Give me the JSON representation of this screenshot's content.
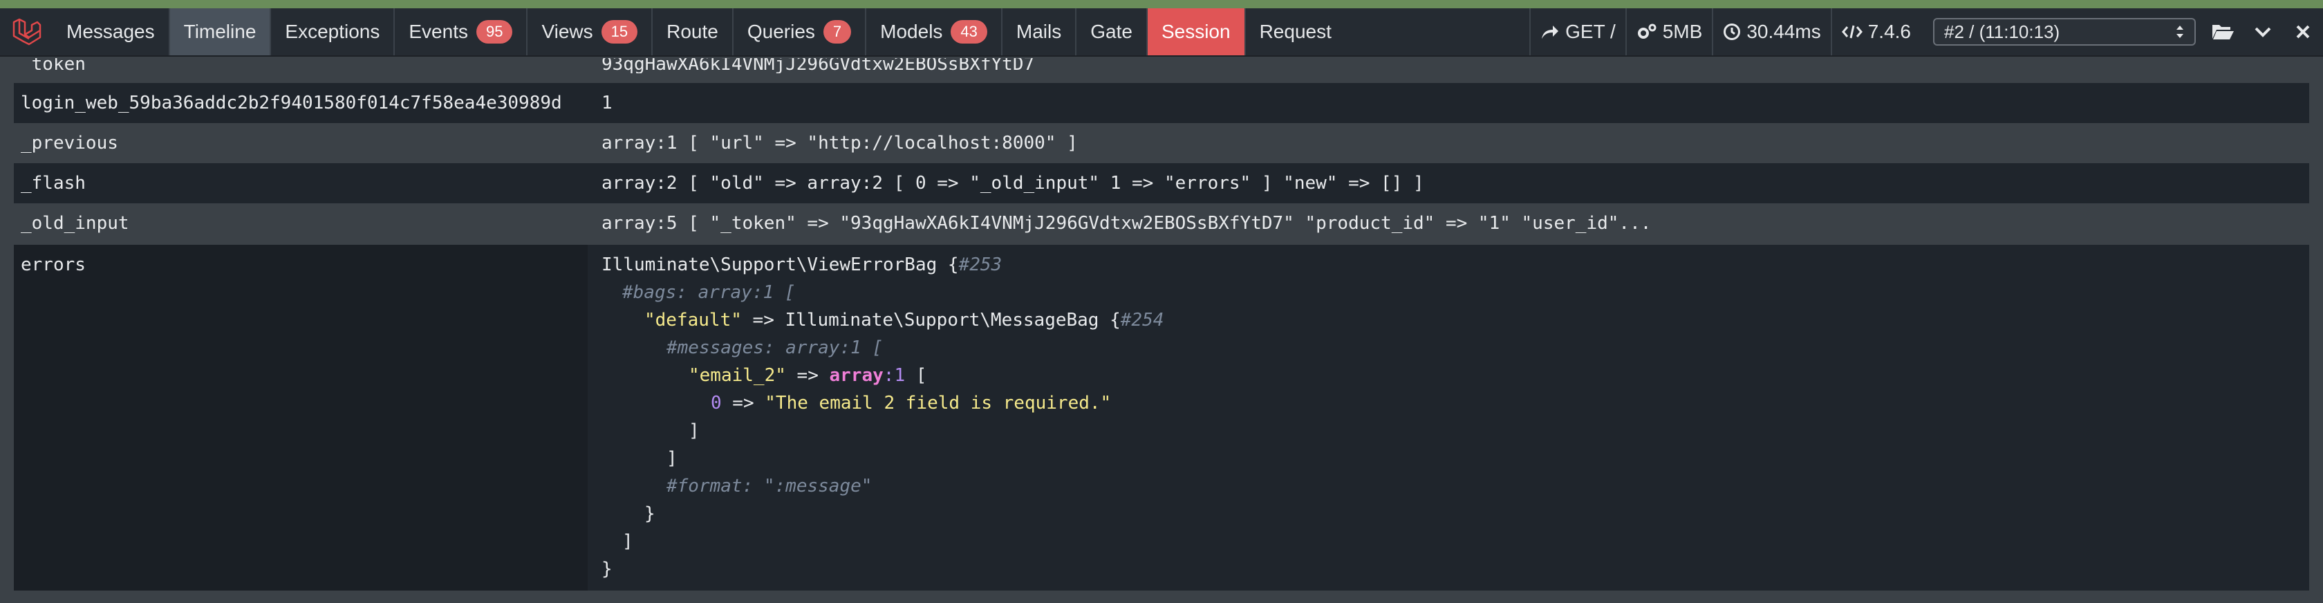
{
  "header": {
    "tabs": [
      {
        "label": "Messages"
      },
      {
        "label": "Timeline",
        "active": true
      },
      {
        "label": "Exceptions"
      },
      {
        "label": "Events",
        "badge": "95"
      },
      {
        "label": "Views",
        "badge": "15"
      },
      {
        "label": "Route"
      },
      {
        "label": "Queries",
        "badge": "7"
      },
      {
        "label": "Models",
        "badge": "43"
      },
      {
        "label": "Mails"
      },
      {
        "label": "Gate"
      },
      {
        "label": "Session",
        "highlight": true
      },
      {
        "label": "Request"
      }
    ],
    "indicators": {
      "method": "GET /",
      "memory": "5MB",
      "duration": "30.44ms",
      "php_version": "7.4.6"
    },
    "request_select": "#2 / (11:10:13)"
  },
  "session": {
    "rows": [
      {
        "key": "_token",
        "value": "93qgHawXA6kI4VNMjJ296GVdtxw2EBOSsBXfYtD7"
      },
      {
        "key": "login_web_59ba36addc2b2f9401580f014c7f58ea4e30989d",
        "value": "1"
      },
      {
        "key": "_previous",
        "value": "array:1 [ \"url\" => \"http://localhost:8000\" ]"
      },
      {
        "key": "_flash",
        "value": "array:2 [ \"old\" => array:2 [ 0 => \"_old_input\" 1 => \"errors\" ] \"new\" => [] ]"
      },
      {
        "key": "_old_input",
        "value": "array:5 [ \"_token\" => \"93qgHawXA6kI4VNMjJ296GVdtxw2EBOSsBXfYtD7\" \"product_id\" => \"1\" \"user_id\"..."
      },
      {
        "key": "errors",
        "value": ""
      }
    ],
    "errors_dump": {
      "class": "Illuminate\\Support\\ViewErrorBag",
      "ref": "#253",
      "bags_meta": "#bags: array:1 [",
      "default_key": "\"default\"",
      "arrow": " => ",
      "inner_class": "Illuminate\\Support\\MessageBag",
      "inner_ref": "#254",
      "messages_meta": "#messages: array:1 [",
      "email_key": "\"email_2\"",
      "array_kw": "array",
      "array_count": ":1",
      "index": "0",
      "message": "\"The email 2 field is required.\"",
      "format_meta": "#format: \":message\""
    }
  }
}
